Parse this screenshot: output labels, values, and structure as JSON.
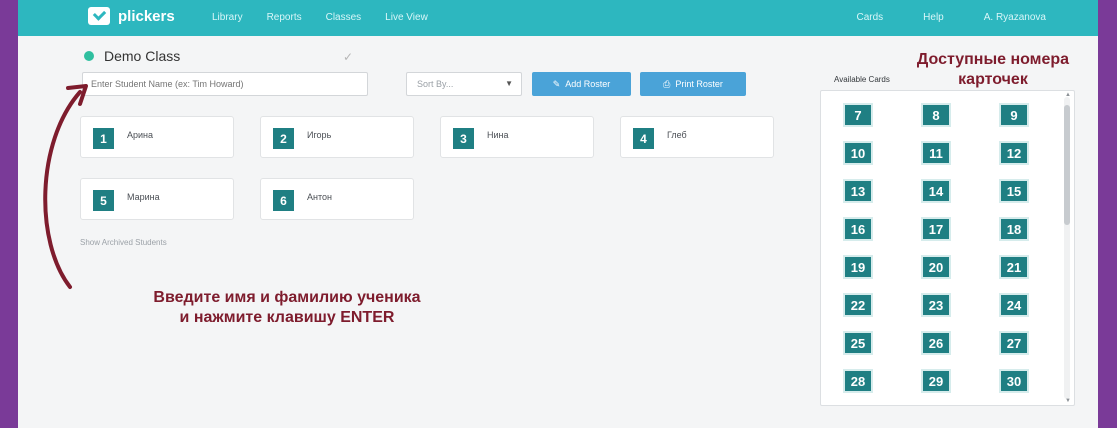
{
  "app": {
    "brand": "plickers",
    "nav_left": [
      "Library",
      "Reports",
      "Classes",
      "Live View"
    ],
    "nav_right": [
      "Cards",
      "Help",
      "A. Ryazanova"
    ],
    "accent": "#2db7bf",
    "frame_color": "#7a3a98"
  },
  "class": {
    "title": "Demo Class",
    "name_placeholder": "Enter Student Name (ex: Tim Howard)",
    "sort_label": "Sort By...",
    "add_button": "Add Roster",
    "print_button": "Print Roster",
    "archived_link": "Show Archived Students"
  },
  "students": [
    {
      "num": "1",
      "name": "Арина"
    },
    {
      "num": "2",
      "name": "Игорь"
    },
    {
      "num": "3",
      "name": "Нина"
    },
    {
      "num": "4",
      "name": "Глеб"
    },
    {
      "num": "5",
      "name": "Марина"
    },
    {
      "num": "6",
      "name": "Антон"
    }
  ],
  "available": {
    "label": "Available Cards",
    "cards": [
      "7",
      "8",
      "9",
      "10",
      "11",
      "12",
      "13",
      "14",
      "15",
      "16",
      "17",
      "18",
      "19",
      "20",
      "21",
      "22",
      "23",
      "24",
      "25",
      "26",
      "27",
      "28",
      "29",
      "30"
    ]
  },
  "annotations": {
    "left_line1": "Введите имя  и фамилию ученика",
    "left_line2": "и нажмите клавишу ENTER",
    "right_line1": "Доступные номера",
    "right_line2": "карточек",
    "color": "#7e1c2d"
  }
}
